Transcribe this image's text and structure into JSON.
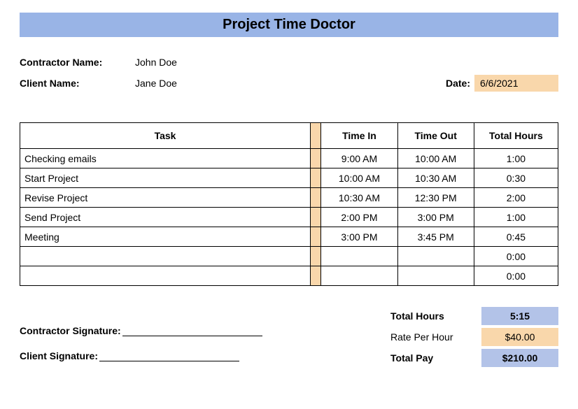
{
  "title": "Project Time Doctor",
  "contractor_label": "Contractor Name:",
  "contractor_name": "John Doe",
  "client_label": "Client Name:",
  "client_name": "Jane Doe",
  "date_label": "Date:",
  "date_value": "6/6/2021",
  "headers": {
    "task": "Task",
    "time_in": "Time In",
    "time_out": "Time Out",
    "total_hours": "Total Hours"
  },
  "rows": [
    {
      "task": "Checking emails",
      "in": "9:00 AM",
      "out": "10:00 AM",
      "total": "1:00"
    },
    {
      "task": "Start Project",
      "in": "10:00 AM",
      "out": "10:30 AM",
      "total": "0:30"
    },
    {
      "task": "Revise Project",
      "in": "10:30 AM",
      "out": "12:30 PM",
      "total": "2:00"
    },
    {
      "task": "Send Project",
      "in": "2:00 PM",
      "out": "3:00 PM",
      "total": "1:00"
    },
    {
      "task": "Meeting",
      "in": "3:00 PM",
      "out": "3:45 PM",
      "total": "0:45"
    },
    {
      "task": "",
      "in": "",
      "out": "",
      "total": "0:00"
    },
    {
      "task": "",
      "in": "",
      "out": "",
      "total": "0:00"
    }
  ],
  "signatures": {
    "contractor": "Contractor Signature:",
    "client": "Client Signature:"
  },
  "summary": {
    "total_hours_label": "Total Hours",
    "total_hours_value": "5:15",
    "rate_label": "Rate Per Hour",
    "rate_value": "$40.00",
    "total_pay_label": "Total Pay",
    "total_pay_value": "$210.00"
  }
}
